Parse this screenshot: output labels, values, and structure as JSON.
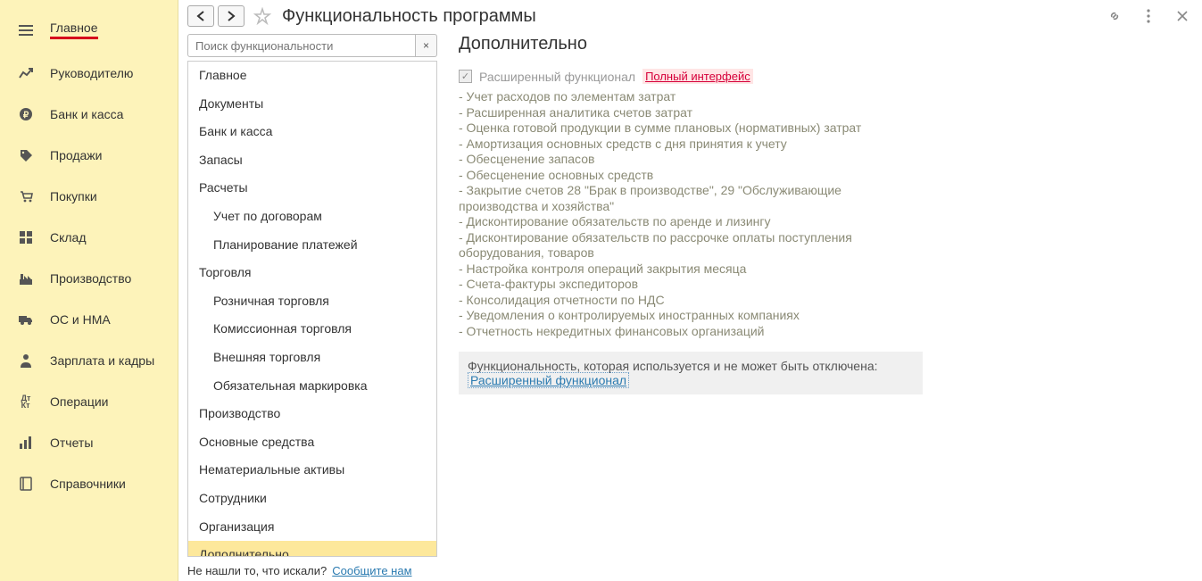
{
  "sidebar": {
    "items": [
      {
        "label": "Главное",
        "icon": "menu"
      },
      {
        "label": "Руководителю",
        "icon": "trend"
      },
      {
        "label": "Банк и касса",
        "icon": "ruble"
      },
      {
        "label": "Продажи",
        "icon": "tag"
      },
      {
        "label": "Покупки",
        "icon": "cart"
      },
      {
        "label": "Склад",
        "icon": "grid"
      },
      {
        "label": "Производство",
        "icon": "factory"
      },
      {
        "label": "ОС и НМА",
        "icon": "truck"
      },
      {
        "label": "Зарплата и кадры",
        "icon": "person"
      },
      {
        "label": "Операции",
        "icon": "dtkt"
      },
      {
        "label": "Отчеты",
        "icon": "bars"
      },
      {
        "label": "Справочники",
        "icon": "book"
      }
    ]
  },
  "page": {
    "title": "Функциональность программы"
  },
  "search": {
    "placeholder": "Поиск функциональности",
    "clear": "×"
  },
  "tree": {
    "items": [
      {
        "label": "Главное",
        "level": 1
      },
      {
        "label": "Документы",
        "level": 1
      },
      {
        "label": "Банк и касса",
        "level": 1
      },
      {
        "label": "Запасы",
        "level": 1
      },
      {
        "label": "Расчеты",
        "level": 1
      },
      {
        "label": "Учет по договорам",
        "level": 2
      },
      {
        "label": "Планирование платежей",
        "level": 2
      },
      {
        "label": "Торговля",
        "level": 1
      },
      {
        "label": "Розничная торговля",
        "level": 2
      },
      {
        "label": "Комиссионная торговля",
        "level": 2
      },
      {
        "label": "Внешняя торговля",
        "level": 2
      },
      {
        "label": "Обязательная маркировка",
        "level": 2
      },
      {
        "label": "Производство",
        "level": 1
      },
      {
        "label": "Основные средства",
        "level": 1
      },
      {
        "label": "Нематериальные активы",
        "level": 1
      },
      {
        "label": "Сотрудники",
        "level": 1
      },
      {
        "label": "Организация",
        "level": 1
      },
      {
        "label": "Дополнительно",
        "level": 1,
        "selected": true
      }
    ]
  },
  "notfound": {
    "text": "Не нашли то, что искали?",
    "link": "Сообщите нам"
  },
  "detail": {
    "title": "Дополнительно",
    "checkbox_label": "Расширенный функционал",
    "interface_link": "Полный интерфейс",
    "desc": [
      "- Учет расходов по элементам затрат",
      "- Расширенная аналитика счетов затрат",
      "- Оценка готовой продукции в сумме плановых (нормативных) затрат",
      "- Амортизация основных средств с дня принятия к учету",
      "- Обесценение запасов",
      "- Обесценение основных средств",
      "- Закрытие счетов 28 \"Брак в производстве\", 29 \"Обслуживающие производства и хозяйства\"",
      "- Дисконтирование обязательств по аренде и лизингу",
      "- Дисконтирование обязательств по рассрочке оплаты поступления оборудования, товаров",
      "- Настройка контроля операций закрытия месяца",
      "- Счета-фактуры экспедиторов",
      "- Консолидация отчетности по НДС",
      "- Уведомления о контролируемых иностранных компаниях",
      "- Отчетность некредитных финансовых организаций"
    ],
    "graybox": {
      "note": "Функциональность, которая используется и не может быть отключена:",
      "link": "Расширенный функционал"
    }
  }
}
